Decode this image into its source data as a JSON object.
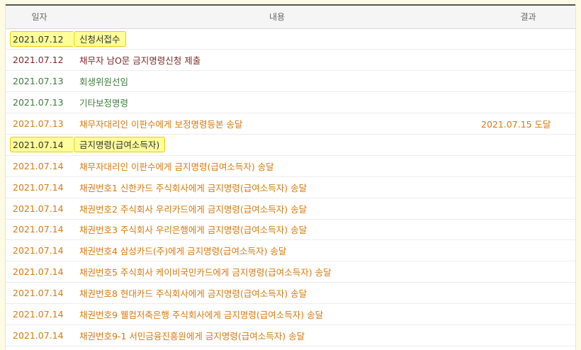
{
  "colors": {
    "maroon": "#7a2a2a",
    "green": "#3e7a3e",
    "orange": "#d77a10",
    "dark": "#333333",
    "highlight_bg": "#ffff99",
    "highlight_border": "#e6cf00"
  },
  "table": {
    "headers": {
      "date": "일자",
      "content": "내용",
      "result": "결과"
    },
    "rows": [
      {
        "date": "2021.07.12",
        "content": "신청서접수",
        "result": "",
        "color": "#333333",
        "highlight": true
      },
      {
        "date": "2021.07.12",
        "content": "채무자 남O문 금지명령신청 제출",
        "result": "",
        "color": "#7a2a2a",
        "highlight": false
      },
      {
        "date": "2021.07.13",
        "content": "회생위원선임",
        "result": "",
        "color": "#3e7a3e",
        "highlight": false
      },
      {
        "date": "2021.07.13",
        "content": "기타보정명령",
        "result": "",
        "color": "#3e7a3e",
        "highlight": false
      },
      {
        "date": "2021.07.13",
        "content": "채무자대리인 이판수에게 보정명령등본 송달",
        "result": "2021.07.15 도달",
        "color": "#d77a10",
        "highlight": false
      },
      {
        "date": "2021.07.14",
        "content": "금지명령(급여소득자)",
        "result": "",
        "color": "#333333",
        "highlight": true
      },
      {
        "date": "2021.07.14",
        "content": "채무자대리인 이판수에게 금지명령(급여소득자) 송달",
        "result": "",
        "color": "#d77a10",
        "highlight": false
      },
      {
        "date": "2021.07.14",
        "content": "채권번호1 신한카드 주식회사에게 금지명령(급여소득자) 송달",
        "result": "",
        "color": "#d77a10",
        "highlight": false
      },
      {
        "date": "2021.07.14",
        "content": "채권번호2 주식회사 우리카드에게 금지명령(급여소득자) 송달",
        "result": "",
        "color": "#d77a10",
        "highlight": false
      },
      {
        "date": "2021.07.14",
        "content": "채권번호3 주식회사 우리은행에게 금지명령(급여소득자) 송달",
        "result": "",
        "color": "#d77a10",
        "highlight": false
      },
      {
        "date": "2021.07.14",
        "content": "채권번호4 삼성카드(주)에게 금지명령(급여소득자) 송달",
        "result": "",
        "color": "#d77a10",
        "highlight": false
      },
      {
        "date": "2021.07.14",
        "content": "채권번호5 주식회사 케이비국민카드에게 금지명령(급여소득자) 송달",
        "result": "",
        "color": "#d77a10",
        "highlight": false
      },
      {
        "date": "2021.07.14",
        "content": "채권번호8 현대카드 주식회사에게 금지명령(급여소득자) 송달",
        "result": "",
        "color": "#d77a10",
        "highlight": false
      },
      {
        "date": "2021.07.14",
        "content": "채권번호9 웰컴저축은행 주식회사에게 금지명령(급여소득자) 송달",
        "result": "",
        "color": "#d77a10",
        "highlight": false
      },
      {
        "date": "2021.07.14",
        "content": "채권번호9-1 서민금융진흥원에게 금지명령(급여소득자) 송달",
        "result": "",
        "color": "#d77a10",
        "highlight": false
      }
    ]
  }
}
